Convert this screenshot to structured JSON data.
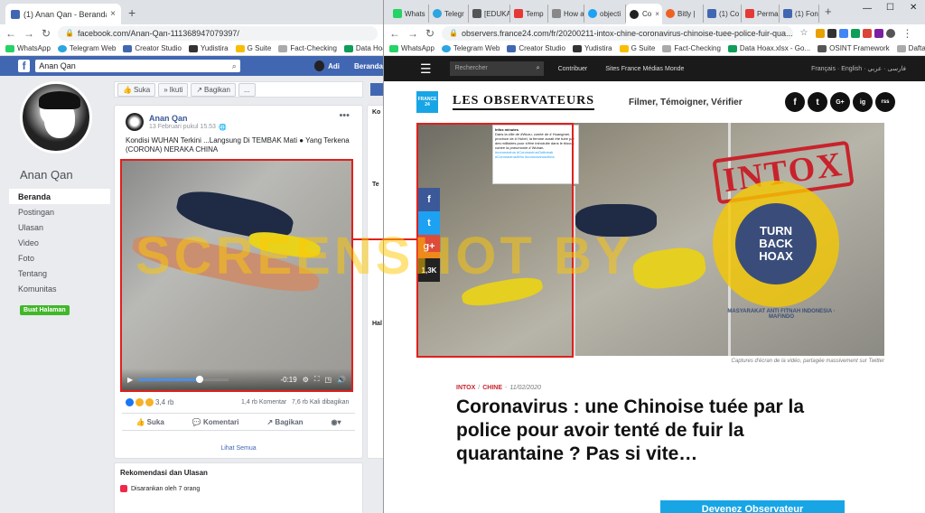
{
  "left_window": {
    "tab": {
      "title": "(1) Anan Qan - Beranda",
      "close": "×",
      "new_tab": "+"
    },
    "address": {
      "url": "facebook.com/Anan-Qan-111368947079397/"
    },
    "bookmarks": [
      "WhatsApp",
      "Telegram Web",
      "Creator Studio",
      "Yudistira",
      "G Suite",
      "Fact-Checking",
      "Data Hoax.xlsx - Go..."
    ],
    "fb_header": {
      "search_value": "Anan Qan",
      "user": "Adi",
      "home": "Beranda"
    },
    "page": {
      "name": "Anan Qan",
      "nav": [
        "Beranda",
        "Postingan",
        "Ulasan",
        "Video",
        "Foto",
        "Tentang",
        "Komunitas"
      ],
      "create_button": "Buat Halaman",
      "actions": [
        "Suka",
        "Ikuti",
        "Bagikan",
        "..."
      ]
    },
    "post": {
      "author": "Anan Qan",
      "time": "13 Februari pukul 15.53",
      "text": "Kondisi WUHAN Terkini ...Langsung Di TEMBAK Mati ● Yang Terkena (CORONA) NERAKA CHINA",
      "video_time": "-0:19",
      "video_progress": 0.68,
      "reactions_count": "3,4 rb",
      "comments": "1,4 rb Komentar",
      "shares": "7,6 rb Kali dibagikan",
      "actions": [
        "Suka",
        "Komentari",
        "Bagikan"
      ],
      "see_all": "Lihat Semua"
    },
    "right_column": {
      "header1": "Ko",
      "header2": "Te",
      "header3": "Hal"
    },
    "recommend": {
      "title": "Rekomendasi dan Ulasan",
      "subtitle": "Disarankan oleh 7 orang"
    },
    "watermark": "SCREENSHOT BY"
  },
  "right_window": {
    "tabs": [
      "Whats",
      "Telegr",
      "[EDUKA",
      "Temp",
      "How a",
      "objecti",
      "Co",
      "Bitly |",
      "(1) Co",
      "Perma",
      "(1) Fon"
    ],
    "window_controls": [
      "—",
      "☐",
      "✕"
    ],
    "address": {
      "url": "observers.france24.com/fr/20200211-intox-chine-coronavirus-chinoise-tuee-police-fuir-qua..."
    },
    "bookmarks": [
      "WhatsApp",
      "Telegram Web",
      "Creator Studio",
      "Yudistira",
      "G Suite",
      "Fact-Checking",
      "Data Hoax.xlsx - Go...",
      "OSINT Framework",
      "Daftar Fact-check..."
    ],
    "site_nav": {
      "search_placeholder": "Rechercher",
      "links": [
        "Contribuer",
        "Sites France Médias Monde"
      ],
      "langs": "Français · English · فارسی · عربي"
    },
    "brand": {
      "france24": "FRANCE 24",
      "logo": "LES OBSERVATEURS",
      "tagline": "Filmer, Témoigner, Vérifier"
    },
    "social_icons": [
      "f",
      "t",
      "G+",
      "ig",
      "rss"
    ],
    "share_bar": {
      "facebook": "f",
      "twitter": "t",
      "gplus": "g+",
      "count": "1,3K"
    },
    "tweet": {
      "account": "Infos minutes",
      "text": "Dans la ville de #Wuzu, comté de # Huangmei, province de # Hubei, la femme aurait été tuée par des militaires pour s'être introduite dans le blocus contre la pneumonie # Wuhan.",
      "tags": "#coronavirus #CoronavirusOutbreak #CoronavirusWho #coronaviruschina"
    },
    "stamp": {
      "intox": "INTOX",
      "turnback": "TURN BACK HOAX",
      "seal": "MASYARAKAT ANTI FITNAH INDONESIA · MAFINDO"
    },
    "caption": "Captures d'écran de la vidéo, partagée massivement sur Twitter",
    "article": {
      "cat1": "INTOX",
      "cat2": "CHINE",
      "date": "11/02/2020",
      "headline": "Coronavirus : une Chinoise tuée par la police pour avoir tenté de fuir la quarantaine ? Pas si vite…",
      "cta": "Devenez Observateur"
    }
  }
}
